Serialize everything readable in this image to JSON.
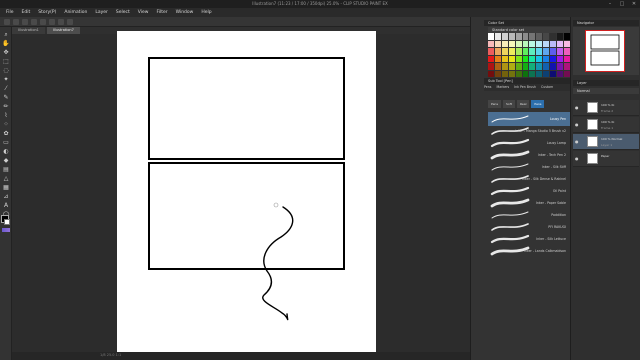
{
  "window": {
    "title": "Illustration7 (11:23 / 17:00 / 350dpi) 25.0% - CLIP STUDIO PAINT EX",
    "minimize_icon": "minimize-icon",
    "maximize_icon": "maximize-icon",
    "close_icon": "close-icon"
  },
  "menu": [
    "File",
    "Edit",
    "Story(P)",
    "Animation",
    "Layer",
    "Select",
    "View",
    "Filter",
    "Window",
    "Help"
  ],
  "tabs": [
    {
      "label": "Illustration1",
      "active": false
    },
    {
      "label": "Illustration7",
      "active": true
    }
  ],
  "tools": [
    "zoom-icon",
    "hand-icon",
    "move-icon",
    "selection-icon",
    "lasso-icon",
    "wand-icon",
    "eyedropper-icon",
    "pen-icon",
    "pencil-icon",
    "brush-icon",
    "airbrush-icon",
    "decoration-icon",
    "eraser-icon",
    "blend-icon",
    "fill-icon",
    "gradient-icon",
    "figure-icon",
    "frame-icon",
    "ruler-icon",
    "text-icon",
    "balloon-icon",
    "line-fix-icon"
  ],
  "colors": {
    "main": "#000000",
    "sub": "#ffffff",
    "selection_accent": "#2c6fad",
    "navigator_frame": "#d02020"
  },
  "color_set": {
    "header": "Color Set",
    "name": "Standard color set"
  },
  "sub_tool": {
    "header": "Sub Tool [Pen]",
    "tabs": [
      "Pens",
      "Markers",
      "Ink Pen Brush",
      "Custom"
    ],
    "buttons": [
      {
        "label": "Pens",
        "selected": false
      },
      {
        "label": "Soft",
        "selected": false
      },
      {
        "label": "Real",
        "selected": false
      },
      {
        "label": "Pens",
        "selected": true
      }
    ],
    "brushes": [
      {
        "name": "Lousy Pen",
        "selected": true
      },
      {
        "name": "Inker - Manga Studio 5 Brush v2",
        "selected": false
      },
      {
        "name": "Lousy Lamp",
        "selected": false
      },
      {
        "name": "Inker - Tech Pen 2",
        "selected": false
      },
      {
        "name": "Inker - Silk Stiff",
        "selected": false
      },
      {
        "name": "Inker - Silk Dense & Rakinel",
        "selected": false
      },
      {
        "name": "Oil Paint",
        "selected": false
      },
      {
        "name": "Inker - Paper Sable",
        "selected": false
      },
      {
        "name": "Poddition",
        "selected": false
      },
      {
        "name": "PFI RAKUGI",
        "selected": false
      },
      {
        "name": "Inker - Silk Lettuce",
        "selected": false
      },
      {
        "name": "Inker - Lands Calkmaidson",
        "selected": false
      }
    ]
  },
  "navigator": {
    "header": "Navigator"
  },
  "layers": {
    "header": "Layer",
    "mode": "Normal",
    "items": [
      {
        "name": "100 % Ki",
        "mode": "Frame 2",
        "selected": false
      },
      {
        "name": "100 % Ki",
        "mode": "Frame 1",
        "selected": false
      },
      {
        "name": "100 % Normal",
        "mode": "Layer 1",
        "selected": true
      },
      {
        "name": "Paper",
        "mode": "",
        "selected": false
      }
    ]
  },
  "status": {
    "text": "1/8 25.0 1:1"
  }
}
